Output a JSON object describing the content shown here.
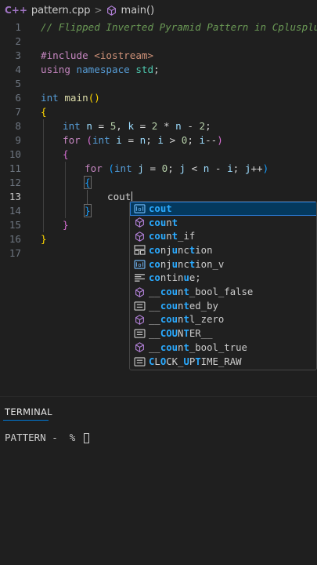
{
  "breadcrumb": {
    "file_icon": "C++",
    "file_name": "pattern.cpp",
    "separator": ">",
    "symbol": "main()"
  },
  "editor": {
    "active_line": 13,
    "lines": [
      {
        "number": "1"
      },
      {
        "number": "2"
      },
      {
        "number": "3"
      },
      {
        "number": "4"
      },
      {
        "number": "5"
      },
      {
        "number": "6"
      },
      {
        "number": "7"
      },
      {
        "number": "8"
      },
      {
        "number": "9"
      },
      {
        "number": "10"
      },
      {
        "number": "11"
      },
      {
        "number": "12"
      },
      {
        "number": "13"
      },
      {
        "number": "14"
      },
      {
        "number": "15"
      },
      {
        "number": "16"
      },
      {
        "number": "17"
      }
    ],
    "tokens": {
      "l1_comment": "// Flipped Inverted Pyramid Pattern in Cplusplus",
      "l3_directive": "#include ",
      "l3_header": "<iostream>",
      "l4_using": "using ",
      "l4_namespace": "namespace ",
      "l4_std": "std",
      "l4_semi": ";",
      "l6_int": "int ",
      "l6_main": "main",
      "l6_parens": "()",
      "l7_brace": "{",
      "l8_int": "int ",
      "l8_n": "n",
      "l8_eq1": " = ",
      "l8_5": "5",
      "l8_comma": ", ",
      "l8_k": "k",
      "l8_eq2": " = ",
      "l8_2a": "2",
      "l8_mul": " * ",
      "l8_n2": "n",
      "l8_minus": " - ",
      "l8_2b": "2",
      "l8_semi": ";",
      "l9_for": "for ",
      "l9_open": "(",
      "l9_int": "int ",
      "l9_i": "i",
      "l9_eq": " = ",
      "l9_n": "n",
      "l9_s1": "; ",
      "l9_i2": "i",
      "l9_gt": " > ",
      "l9_0": "0",
      "l9_s2": "; ",
      "l9_i3": "i",
      "l9_dec": "--",
      "l9_close": ")",
      "l10_brace": "{",
      "l11_for": "for ",
      "l11_open": "(",
      "l11_int": "int ",
      "l11_j": "j",
      "l11_eq": " = ",
      "l11_0": "0",
      "l11_s1": "; ",
      "l11_j2": "j",
      "l11_lt": " < ",
      "l11_n": "n",
      "l11_minus": " - ",
      "l11_i": "i",
      "l11_s2": "; ",
      "l11_j3": "j",
      "l11_inc": "++",
      "l11_close": ")",
      "l12_brace": "{",
      "l13_cout": "cout",
      "l14_brace": "}",
      "l15_brace": "}",
      "l16_brace": "}"
    }
  },
  "suggestions": {
    "typed": "cout",
    "items": [
      {
        "label": "cout",
        "kind": "variable-icon",
        "selected": true
      },
      {
        "label": "count",
        "kind": "method-cube-icon",
        "selected": false
      },
      {
        "label": "count_if",
        "kind": "method-cube-icon",
        "selected": false
      },
      {
        "label": "conjunction",
        "kind": "class-icon",
        "selected": false
      },
      {
        "label": "conjunction_v",
        "kind": "variable-icon",
        "selected": false
      },
      {
        "label": "continue;",
        "kind": "snippet-icon",
        "selected": false
      },
      {
        "label": "__count_bool_false",
        "kind": "method-cube-icon",
        "selected": false
      },
      {
        "label": "__counted_by",
        "kind": "text-icon",
        "selected": false
      },
      {
        "label": "__countl_zero",
        "kind": "method-cube-icon",
        "selected": false
      },
      {
        "label": "__COUNTER__",
        "kind": "text-icon",
        "selected": false
      },
      {
        "label": "__count_bool_true",
        "kind": "method-cube-icon",
        "selected": false
      },
      {
        "label": "CLOCK_UPTIME_RAW",
        "kind": "text-icon",
        "selected": false
      }
    ]
  },
  "terminal": {
    "tab_label": "TERMINAL",
    "prompt": "PATTERN -  % "
  },
  "colors": {
    "background": "#1f1f1f",
    "selection": "#04395e",
    "match_highlight": "#2aaaff",
    "terminal_tab_underline": "#0078d4"
  }
}
